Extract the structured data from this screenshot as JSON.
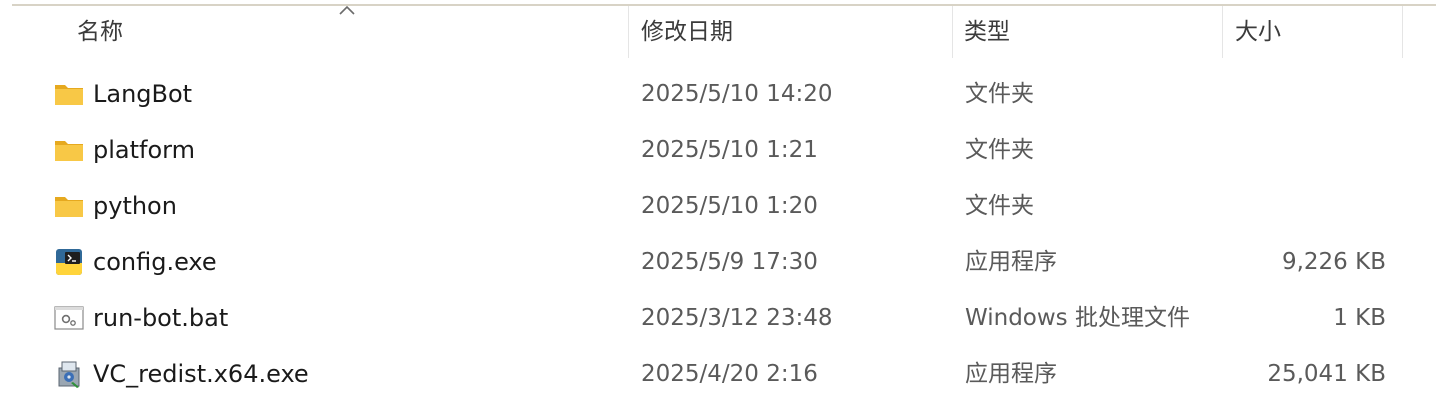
{
  "header": {
    "name": "名称",
    "date_modified": "修改日期",
    "type": "类型",
    "size": "大小",
    "sort_icon": "chevron-up-icon"
  },
  "files": [
    {
      "name": "LangBot",
      "date": "2025/5/10 14:20",
      "type": "文件夹",
      "size": "",
      "icon": "folder-icon"
    },
    {
      "name": "platform",
      "date": "2025/5/10 1:21",
      "type": "文件夹",
      "size": "",
      "icon": "folder-icon"
    },
    {
      "name": "python",
      "date": "2025/5/10 1:20",
      "type": "文件夹",
      "size": "",
      "icon": "folder-icon"
    },
    {
      "name": "config.exe",
      "date": "2025/5/9 17:30",
      "type": "应用程序",
      "size": "9,226 KB",
      "icon": "python-exe-icon"
    },
    {
      "name": "run-bot.bat",
      "date": "2025/3/12 23:48",
      "type": "Windows 批处理文件",
      "size": "1 KB",
      "icon": "batch-file-icon"
    },
    {
      "name": "VC_redist.x64.exe",
      "date": "2025/4/20 2:16",
      "type": "应用程序",
      "size": "25,041 KB",
      "icon": "installer-icon"
    }
  ],
  "colors": {
    "folder": "#f8c846",
    "folder_dark": "#e6a91f",
    "text_primary": "#1a1a1a",
    "text_secondary": "#5a5a5a"
  }
}
